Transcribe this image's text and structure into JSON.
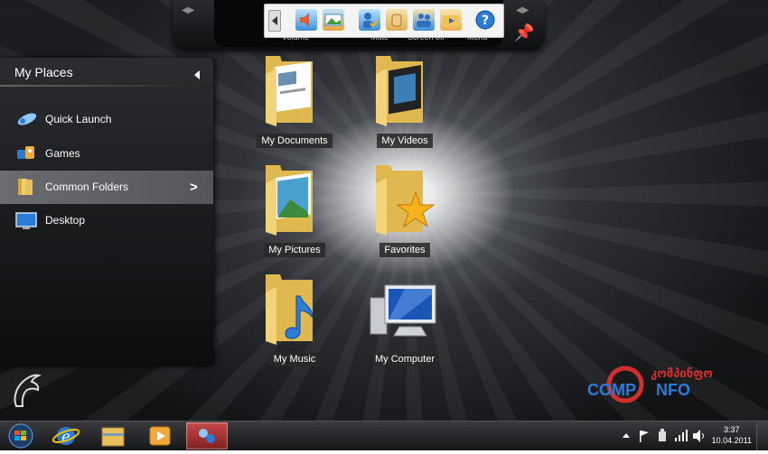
{
  "toolbar": {
    "labels": {
      "volume": "Volume",
      "mute": "Mute",
      "screen_off": "Screen off",
      "menu": "Menu"
    },
    "volume_indicator": "– • • –"
  },
  "sidebar": {
    "title": "My Places",
    "items": [
      {
        "label": "Quick Launch",
        "icon": "rocket-icon"
      },
      {
        "label": "Games",
        "icon": "games-icon"
      },
      {
        "label": "Common Folders",
        "icon": "folder-icon",
        "selected": true
      },
      {
        "label": "Desktop",
        "icon": "monitor-icon"
      }
    ]
  },
  "desktop": {
    "icons": [
      {
        "label": "My Documents"
      },
      {
        "label": "My Videos"
      },
      {
        "label": "My Pictures"
      },
      {
        "label": "Favorites"
      },
      {
        "label": "My Music"
      },
      {
        "label": "My Computer"
      }
    ]
  },
  "logo": {
    "text_top": "კომპინფო",
    "text_left": "COMP",
    "text_right": "NFO"
  },
  "clock": {
    "time": "3:37",
    "date": "10.04.2011"
  },
  "colors": {
    "accent_red": "#d32f2f",
    "logo_blue": "#2c7bd6",
    "selected_item": "#5e5f63"
  }
}
